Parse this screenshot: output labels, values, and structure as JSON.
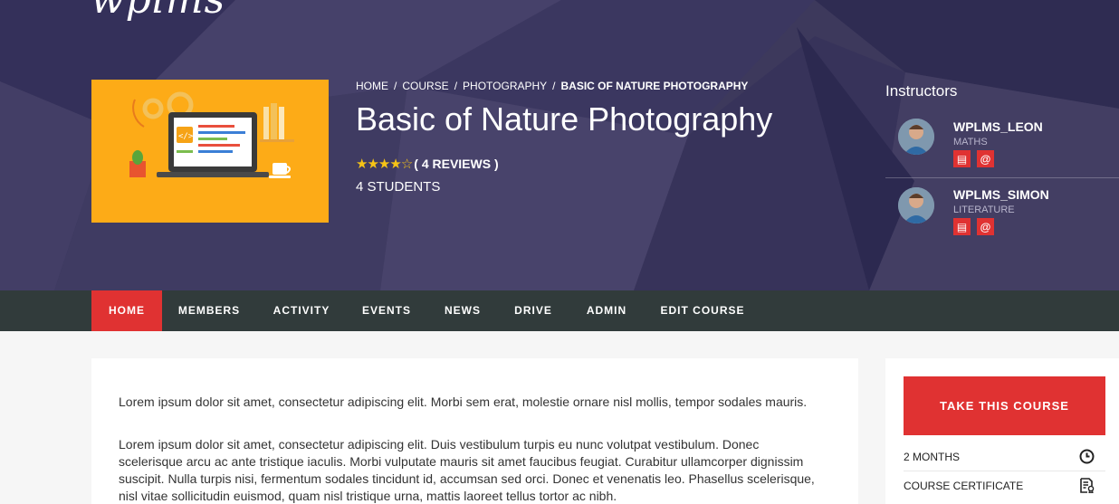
{
  "brand": {
    "logo_text": "wplms"
  },
  "breadcrumb": {
    "items": [
      "HOME",
      "COURSE",
      "PHOTOGRAPHY"
    ],
    "separator": "/",
    "current": "BASIC OF NATURE PHOTOGRAPHY"
  },
  "course": {
    "title": "Basic of Nature Photography",
    "rating": 4,
    "rating_max": 5,
    "reviews_label": "( 4 REVIEWS )",
    "students_label": "4 STUDENTS",
    "thumbnail_icon": "laptop-code-illustration"
  },
  "instructors": {
    "title": "Instructors",
    "items": [
      {
        "name": "WPLMS_LEON",
        "subject": "MATHS"
      },
      {
        "name": "WPLMS_SIMON",
        "subject": "LITERATURE"
      }
    ]
  },
  "nav": {
    "items": [
      "HOME",
      "MEMBERS",
      "ACTIVITY",
      "EVENTS",
      "NEWS",
      "DRIVE",
      "ADMIN",
      "EDIT COURSE"
    ],
    "active": "HOME"
  },
  "description": {
    "p1": "Lorem ipsum dolor sit amet, consectetur adipiscing elit. Morbi sem erat, molestie ornare nisl mollis, tempor sodales mauris.",
    "p2": "Lorem ipsum dolor sit amet, consectetur adipiscing elit. Duis vestibulum turpis eu nunc volutpat vestibulum. Donec scelerisque arcu ac ante tristique iaculis. Morbi vulputate mauris sit amet faucibus feugiat. Curabitur ullamcorper dignissim suscipit. Nulla turpis nisi, fermentum sodales tincidunt id, accumsan sed orci. Donec et venenatis leo. Phasellus scelerisque, nisl vitae sollicitudin euismod, quam nisl tristique urna, mattis laoreet tellus tortor ac nibh."
  },
  "sidebar": {
    "cta_label": "TAKE THIS COURSE",
    "details": [
      {
        "label": "2 MONTHS",
        "icon": "clock-icon"
      },
      {
        "label": "COURSE CERTIFICATE",
        "icon": "certificate-icon"
      }
    ]
  },
  "colors": {
    "accent": "#e03232",
    "hero_bg": "#3f3a5e",
    "nav_bg": "#313b3b",
    "thumb_bg": "#fdab17",
    "star": "#f6c416"
  }
}
